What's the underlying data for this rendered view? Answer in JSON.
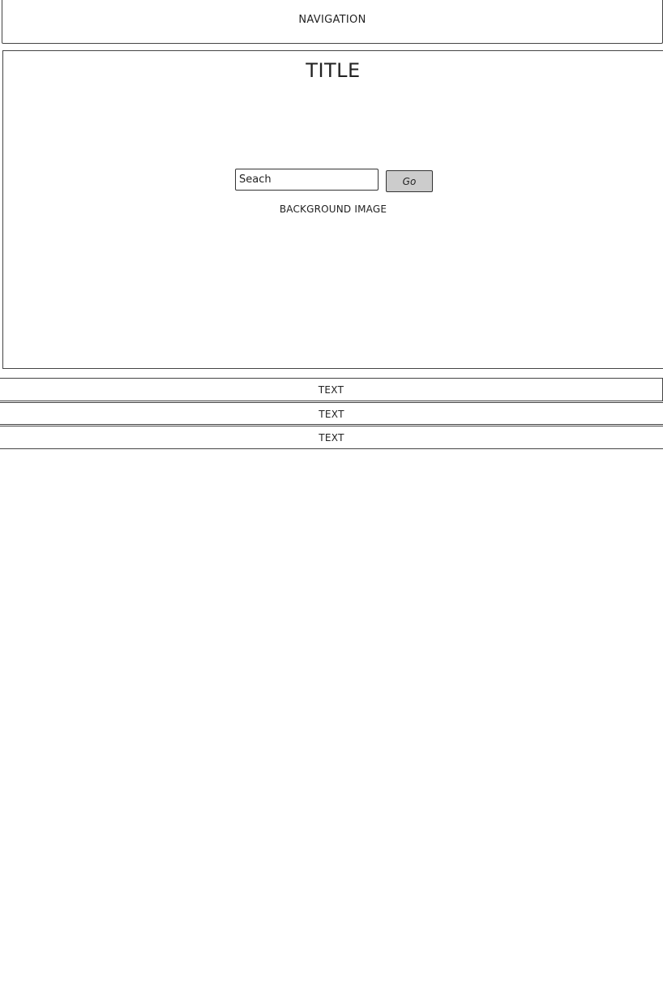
{
  "navigation": {
    "label": "NAVIGATION"
  },
  "hero": {
    "title": "TITLE",
    "search": {
      "placeholder": "Seach",
      "button_label": "Go"
    },
    "background_label": "BACKGROUND IMAGE"
  },
  "text_rows": [
    {
      "label": "TEXT"
    },
    {
      "label": "TEXT"
    },
    {
      "label": "TEXT"
    }
  ],
  "colors": {
    "border": "#444444",
    "button_fill": "#cccccc",
    "background": "#ffffff"
  }
}
